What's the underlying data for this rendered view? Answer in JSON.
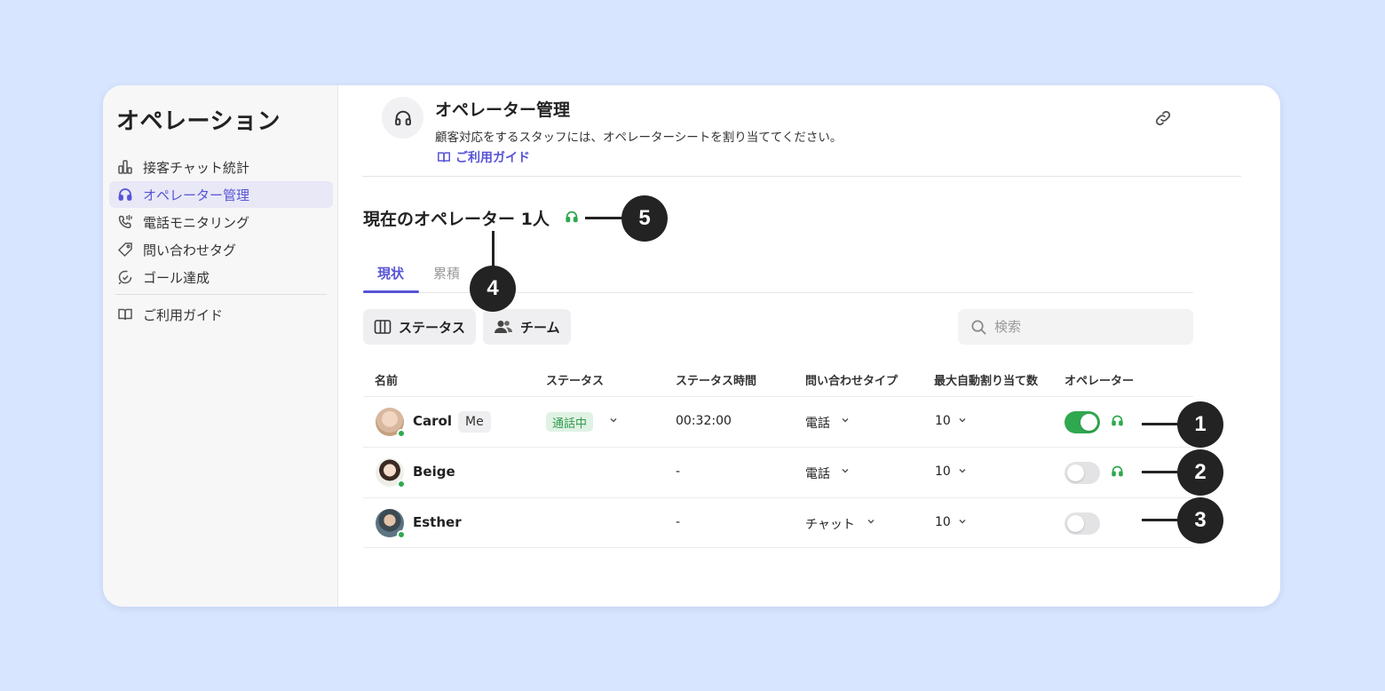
{
  "colors": {
    "accent": "#5754d6",
    "online": "#2fa84f",
    "status_bg": "#dff2e3",
    "page_bg": "#d7e5fe"
  },
  "sidebar": {
    "title": "オペレーション",
    "items": [
      {
        "label": "接客チャット統計",
        "icon": "bar-chart-icon",
        "active": false
      },
      {
        "label": "オペレーター管理",
        "icon": "headset-icon",
        "active": true
      },
      {
        "label": "電話モニタリング",
        "icon": "phone-icon",
        "active": false
      },
      {
        "label": "問い合わせタグ",
        "icon": "tag-icon",
        "active": false
      },
      {
        "label": "ゴール達成",
        "icon": "goal-icon",
        "active": false
      }
    ],
    "guide_label": "ご利用ガイド"
  },
  "header": {
    "title": "オペレーター管理",
    "description": "顧客対応をするスタッフには、オペレーターシートを割り当ててください。",
    "guide_link": "ご利用ガイド"
  },
  "operators_title": "現在のオペレーター 1人",
  "tabs": [
    {
      "label": "現状",
      "active": true
    },
    {
      "label": "累積",
      "active": false
    }
  ],
  "filters": {
    "status_label": "ステータス",
    "team_label": "チーム",
    "search_placeholder": "検索"
  },
  "table": {
    "columns": [
      "名前",
      "ステータス",
      "ステータス時間",
      "問い合わせタイプ",
      "最大自動割り当て数",
      "オペレーター"
    ],
    "rows": [
      {
        "name": "Carol",
        "badge": "Me",
        "status": "通話中",
        "status_time": "00:32:00",
        "inquiry_type": "電話",
        "max_assign": "10",
        "operator_on": true,
        "headset": true
      },
      {
        "name": "Beige",
        "badge": "",
        "status": "",
        "status_time": "-",
        "inquiry_type": "電話",
        "max_assign": "10",
        "operator_on": false,
        "headset": true
      },
      {
        "name": "Esther",
        "badge": "",
        "status": "",
        "status_time": "-",
        "inquiry_type": "チャット",
        "max_assign": "10",
        "operator_on": false,
        "headset": false
      }
    ]
  },
  "callouts": [
    "1",
    "2",
    "3",
    "4",
    "5"
  ]
}
